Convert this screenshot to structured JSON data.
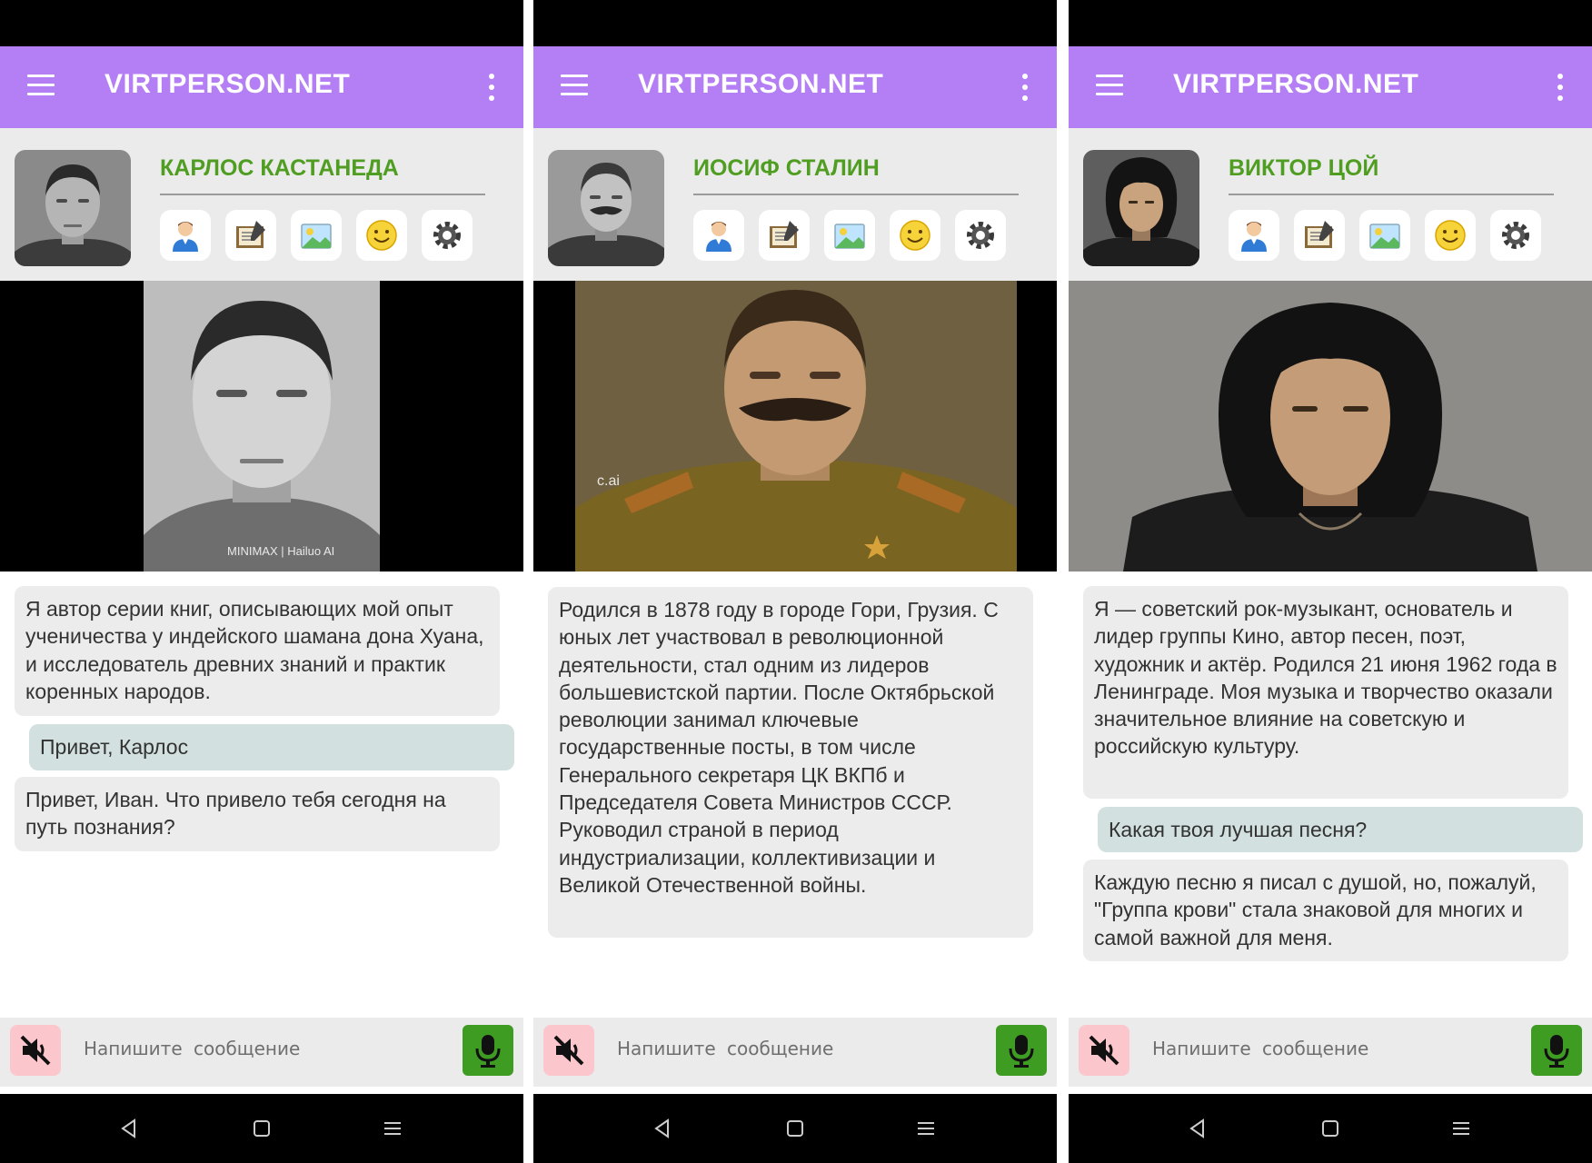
{
  "app": {
    "title": "VIRTPERSON.NET",
    "accent_color": "#b47ef4",
    "name_color": "#4f9d21"
  },
  "profile_buttons": [
    "person-icon",
    "notebook-icon",
    "picture-icon",
    "smiley-icon",
    "gear-icon"
  ],
  "input": {
    "placeholder": "Напишите сообщение"
  },
  "panels": [
    {
      "name": "КАРЛОС КАСТАНЕДА",
      "watermark": "MINIMAX | Hailuo AI",
      "messages": [
        {
          "role": "bot",
          "text": "Я автор серии книг, описывающих мой опыт ученичества у индейского шамана дона Хуана, и исследователь древних знаний и практик коренных народов."
        },
        {
          "role": "user",
          "text": "Привет, Карлос"
        },
        {
          "role": "bot",
          "text": "Привет, Иван. Что привело тебя сегодня на путь познания?"
        }
      ]
    },
    {
      "name": "ИОСИФ СТАЛИН",
      "watermark": "c.ai",
      "messages": [
        {
          "role": "bot",
          "text": "Родился в 1878 году в городе Гори, Грузия. С юных лет участвовал в революционной деятельности, стал одним из лидеров большевистской партии. После Октябрьской революции занимал ключевые государственные посты, в том числе Генерального секретаря ЦК ВКПб и Председателя Совета Министров СССР. Руководил страной в период индустриализации, коллективизации и Великой Отечественной войны."
        }
      ]
    },
    {
      "name": "ВИКТОР ЦОЙ",
      "watermark": "",
      "messages": [
        {
          "role": "bot",
          "text": "Я — советский рок-музыкант, основатель и лидер группы Кино, автор песен, поэт, художник и актёр. Родился 21 июня 1962 года в Ленинграде. Моя музыка и творчество оказали значительное влияние на советскую и российскую культуру."
        },
        {
          "role": "user",
          "text": "Какая твоя лучшая песня?"
        },
        {
          "role": "bot",
          "text": "Каждую песню я писал с душой, но, пожалуй, \"Группа крови\" стала знаковой для многих и самой важной для меня."
        }
      ]
    }
  ]
}
